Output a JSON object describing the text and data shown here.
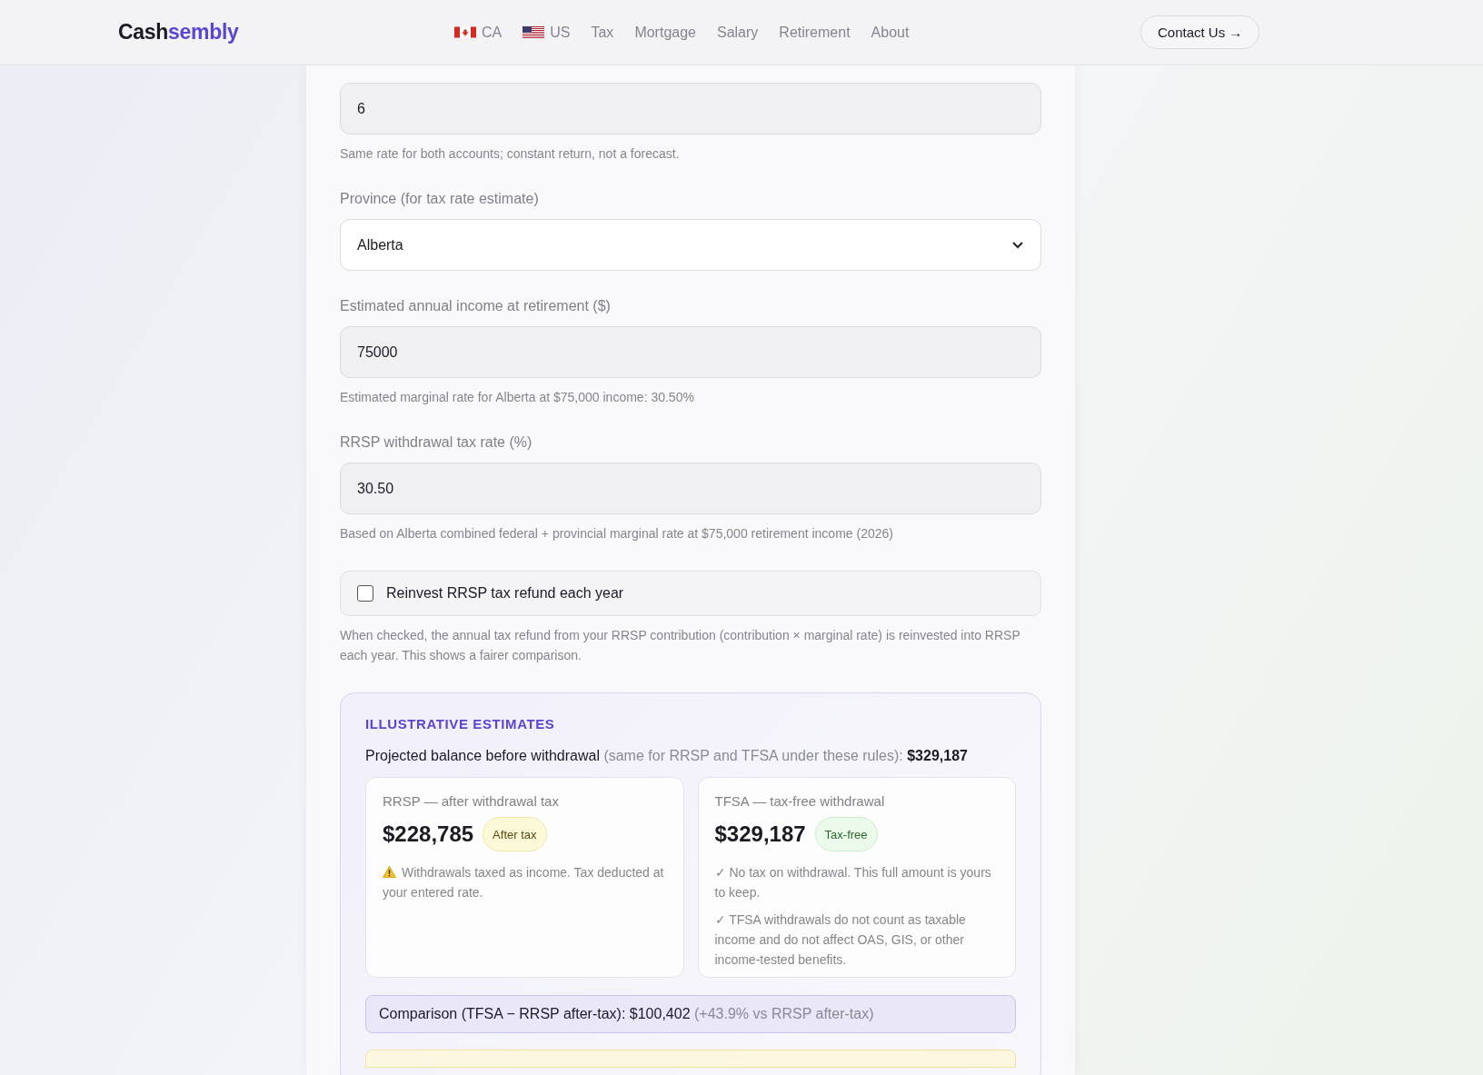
{
  "header": {
    "logo": [
      {
        "text": "Cash",
        "kind": "plain"
      },
      {
        "text": "sembly",
        "kind": "accent"
      }
    ],
    "nav": [
      {
        "label": "CA",
        "kind": "canada"
      },
      {
        "label": "US",
        "kind": "usa"
      },
      {
        "label": "Tax",
        "kind": "link"
      },
      {
        "label": "Mortgage",
        "kind": "link"
      },
      {
        "label": "Salary",
        "kind": "link"
      },
      {
        "label": "Retirement",
        "kind": "link"
      },
      {
        "label": "About",
        "kind": "link"
      }
    ],
    "contact_button": "Contact Us →"
  },
  "form": {
    "fields": [
      {
        "kind": "input",
        "value": "6",
        "help": "Same rate for both accounts; constant return, not a forecast."
      },
      {
        "kind": "select",
        "label": "Province (for tax rate estimate)",
        "value": "Alberta"
      },
      {
        "kind": "input",
        "label": "Estimated annual income at retirement ($)",
        "value": "75000",
        "help": "Estimated marginal rate for Alberta at $75,000 income: 30.50%"
      },
      {
        "kind": "input",
        "label": "RRSP withdrawal tax rate (%)",
        "value": "30.50",
        "help": "Based on Alberta combined federal + provincial marginal rate at $75,000 retirement income (2026)"
      },
      {
        "kind": "checkbox",
        "label": "Reinvest RRSP tax refund each year",
        "checked": false,
        "help": "When checked, the annual tax refund from your RRSP contribution (contribution × marginal rate) is reinvested into RRSP each year. This shows a fairer comparison."
      }
    ]
  },
  "estimates": {
    "title": "ILLUSTRATIVE ESTIMATES",
    "projected": {
      "label": "Projected balance before withdrawal",
      "note": "(same for RRSP and TFSA under these rules):",
      "amount": "$329,187"
    },
    "cards": [
      {
        "title": "RRSP — after withdrawal tax",
        "amount": "$228,785",
        "badge": {
          "label": "After tax",
          "kind": "warn"
        },
        "notes": [
          {
            "kind": "warning",
            "text": "Withdrawals taxed as income. Tax deducted at your entered rate."
          }
        ]
      },
      {
        "title": "TFSA — tax-free withdrawal",
        "amount": "$329,187",
        "badge": {
          "label": "Tax-free",
          "kind": "ok"
        },
        "notes": [
          {
            "text": "✓ No tax on withdrawal. This full amount is yours to keep."
          },
          {
            "text": "✓ TFSA withdrawals do not count as taxable income and do not affect OAS, GIS, or other income-tested benefits."
          }
        ]
      }
    ],
    "comparison": {
      "label": "Comparison (TFSA − RRSP after-tax): $100,402",
      "note": "(+43.9% vs RRSP after-tax)"
    }
  }
}
